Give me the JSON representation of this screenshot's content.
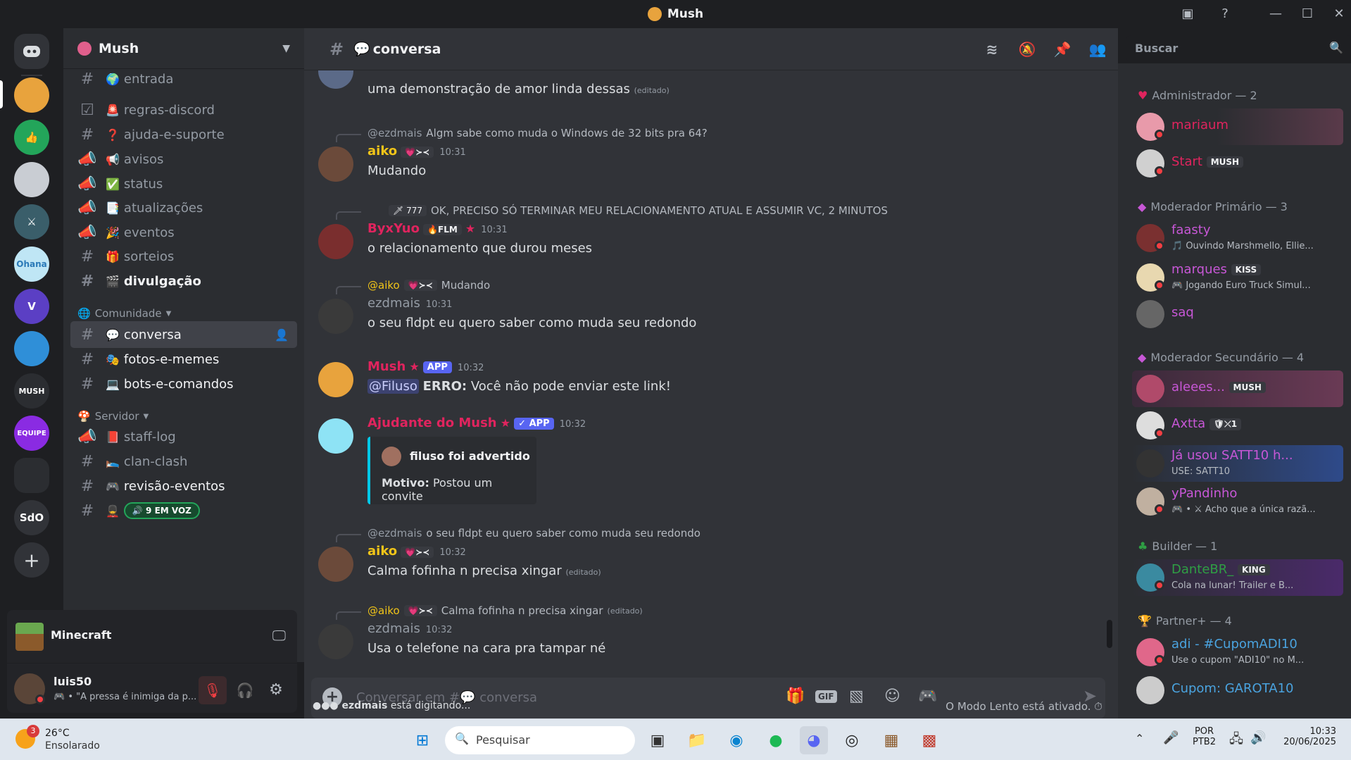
{
  "window": {
    "title": "Mush"
  },
  "server": {
    "name": "Mush"
  },
  "guild_labels": {
    "sdo": "SdO"
  },
  "channels": [
    {
      "name": "entrada",
      "emoji": "🌍",
      "type": "text"
    },
    {
      "name": "regras-discord",
      "emoji": "🚨",
      "type": "rules"
    },
    {
      "name": "ajuda-e-suporte",
      "emoji": "❓",
      "type": "text"
    },
    {
      "name": "avisos",
      "emoji": "📢",
      "type": "announce"
    },
    {
      "name": "status",
      "emoji": "✅",
      "type": "announce"
    },
    {
      "name": "atualizações",
      "emoji": "📑",
      "type": "announce"
    },
    {
      "name": "eventos",
      "emoji": "🎉",
      "type": "announce"
    },
    {
      "name": "sorteios",
      "emoji": "🎁",
      "type": "text"
    },
    {
      "name": "divulgação",
      "emoji": "🎬",
      "type": "text"
    }
  ],
  "categories": {
    "comunidade": "Comunidade",
    "servidor": "Servidor"
  },
  "comunidade_channels": [
    {
      "name": "conversa",
      "emoji": "💬"
    },
    {
      "name": "fotos-e-memes",
      "emoji": "🎭"
    },
    {
      "name": "bots-e-comandos",
      "emoji": "💻"
    }
  ],
  "servidor_channels": [
    {
      "name": "staff-log",
      "emoji": "📕"
    },
    {
      "name": "clan-clash",
      "emoji": "🛌"
    },
    {
      "name": "revisão-eventos",
      "emoji": "🎮"
    }
  ],
  "voice_pill": {
    "label": "9 EM VOZ"
  },
  "activity": {
    "game": "Minecraft"
  },
  "user": {
    "name": "luis50",
    "status": "• \"A pressa é inimiga da p..."
  },
  "channel_header": {
    "name": "conversa",
    "emoji": "💬"
  },
  "search": {
    "placeholder": "Buscar"
  },
  "messages": {
    "m0": {
      "text": "uma demonstração de amor linda dessas",
      "edited": "(editado)"
    },
    "m1": {
      "reply_user": "@ezdmais",
      "reply_text": "Algm sabe como muda o Windows de 32 bits pra 64?",
      "user": "aiko",
      "tag": "💗≻≺",
      "time": "10:31",
      "text": "Mudando"
    },
    "m2": {
      "reply_user": "777",
      "reply_text": "OK, PRECISO SÓ TERMINAR MEU RELACIONAMENTO ATUAL E ASSUMIR VC, 2 MINUTOS",
      "user": "ByxYuo",
      "tag": "🔥FLM",
      "time": "10:31",
      "text": "o relacionamento que durou meses"
    },
    "m3": {
      "reply_user": "@aiko",
      "reply_tag": "💗≻≺",
      "reply_text": "Mudando",
      "user": "ezdmais",
      "time": "10:31",
      "text": "o seu fldpt eu quero saber como muda seu redondo"
    },
    "m4": {
      "user": "Mush",
      "tag": "APP",
      "time": "10:32",
      "mention": "@Filuso",
      "bold": "ERRO:",
      "text": "Você não pode enviar este link!"
    },
    "m5": {
      "user": "Ajudante do Mush",
      "tag": "✓ APP",
      "time": "10:32",
      "embed_title": "filuso foi advertido",
      "embed_label": "Motivo:",
      "embed_value": "Postou um convite"
    },
    "m6": {
      "reply_user": "@ezdmais",
      "reply_text": "o seu fldpt eu quero saber como muda seu redondo",
      "user": "aiko",
      "tag": "💗≻≺",
      "time": "10:32",
      "text": "Calma fofinha n precisa xingar",
      "edited": "(editado)"
    },
    "m7": {
      "reply_user": "@aiko",
      "reply_tag": "💗≻≺",
      "reply_text": "Calma fofinha n precisa xingar",
      "reply_edited": "(editado)",
      "user": "ezdmais",
      "time": "10:32",
      "text": "Usa o telefone na cara pra tampar né"
    }
  },
  "composer": {
    "placeholder_prefix": "Conversar em #",
    "placeholder_channel": "💬 conversa"
  },
  "typing": {
    "user": "ezdmais",
    "suffix": "está digitando...",
    "slowmode": "O Modo Lento está ativado."
  },
  "roles": {
    "admin": "Administrador — 2",
    "modp": "Moderador Primário — 3",
    "mods": "Moderador Secundário — 4",
    "builder": "Builder — 1",
    "partner": "Partner+ — 4"
  },
  "members": {
    "mariaum": {
      "name": "mariaum",
      "color": "#e0245e"
    },
    "start": {
      "name": "Start",
      "tag": "MUSH",
      "color": "#e0245e"
    },
    "faasty": {
      "name": "faasty",
      "status": "🎵 Ouvindo Marshmello, Ellie...",
      "color": "#c757d6"
    },
    "marques": {
      "name": "marques",
      "tag": "KISS",
      "status": "🎮 Jogando Euro Truck Simul...",
      "color": "#c757d6"
    },
    "saq": {
      "name": "saq",
      "color": "#c757d6"
    },
    "aleees": {
      "name": "aleees...",
      "tag": "MUSH",
      "color": "#c757d6"
    },
    "axtta": {
      "name": "Axtta",
      "tag": "🛡⤫1",
      "color": "#c757d6"
    },
    "satt": {
      "name": "Já usou SATT10 h...",
      "status": "USE: SATT10",
      "color": "#c757d6"
    },
    "ypandinho": {
      "name": "yPandinho",
      "status": "🎮 • ⚔ Acho que a única razã...",
      "color": "#c757d6"
    },
    "dante": {
      "name": "DanteBR_",
      "tag": "KING",
      "status": "Cola na lunar! Trailer e B...",
      "color": "#2f9e44"
    },
    "adi": {
      "name": "adi - #CupomADI10",
      "status": "Use o cupom \"ADI10\" no M...",
      "color": "#4aa3df"
    },
    "cupom": {
      "name": "Cupom: GAROTA10",
      "color": "#4aa3df"
    }
  },
  "taskbar": {
    "weather_temp": "26°C",
    "weather_desc": "Ensolarado",
    "weather_badge": "3",
    "search": "Pesquisar",
    "lang": "POR",
    "layout": "PTB2",
    "time": "10:33",
    "date": "20/06/2025"
  }
}
